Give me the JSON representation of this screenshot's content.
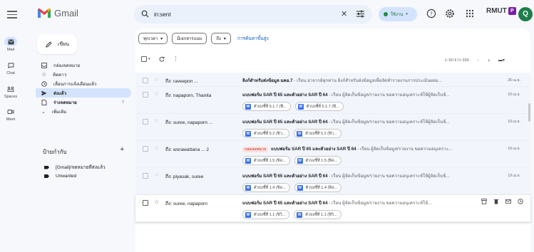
{
  "app": {
    "name": "Gmail"
  },
  "search": {
    "value": "in:sent",
    "clear_glyph": "✕"
  },
  "status": {
    "label": "ใช้งาน"
  },
  "account": {
    "org": "RMUT",
    "badge": "P",
    "avatar_letter": "Q"
  },
  "rail": [
    {
      "label": "Mail",
      "icon": "mail-icon"
    },
    {
      "label": "Chat",
      "icon": "chat-icon"
    },
    {
      "label": "Spaces",
      "icon": "spaces-icon"
    },
    {
      "label": "Meet",
      "icon": "meet-icon"
    }
  ],
  "compose": {
    "label": "เขียน"
  },
  "nav": [
    {
      "label": "กล่องจดหมาย",
      "icon": "inbox-icon",
      "count": ""
    },
    {
      "label": "ติดดาว",
      "icon": "star-icon",
      "count": ""
    },
    {
      "label": "เลื่อนการแจ้งเตือนแล้ว",
      "icon": "clock-icon",
      "count": ""
    },
    {
      "label": "ส่งแล้ว",
      "icon": "send-icon",
      "count": ""
    },
    {
      "label": "ร่างจดหมาย",
      "icon": "draft-icon",
      "count": "7"
    },
    {
      "label": "เพิ่มเติม",
      "icon": "chevron-down-icon",
      "count": ""
    }
  ],
  "labels": {
    "heading": "ป้ายกำกับ",
    "items": [
      "[Gmail]/จดหมายที่ส่งแล้ว",
      "Unwanted"
    ]
  },
  "filters": {
    "chips": [
      "ทุกเวลา",
      "มีเอกสารแนบ",
      "ถึง"
    ],
    "advanced": "การค้นหาขั้นสูง"
  },
  "pager": {
    "text": "1–50 จาก 339"
  },
  "rows": [
    {
      "sender": "ถึง: raveepon ...",
      "tag": "",
      "subject": "ลิงก์สำหรับส่งข้อมูล มคอ.7",
      "snippet": " - เรียน อาจารย์ทุกท่าน ลิงก์สำหรับส่งข้อมูลเพื่อจัดทำรายงานการประเมินผลม...",
      "date": "26 เม.ย.",
      "attachments": []
    },
    {
      "sender": "ถึง: napaporn, Thanita",
      "tag": "",
      "subject": "แบบฟอร์ม SAR ปี 65 และตัวอย่าง SAR ปี 64",
      "snippet": " - เรียน ผู้จัดเก็บข้อมูล/รายงาน ขอความอนุเคราะห์ให้ผู้จัดเก็บข้...",
      "date": "19 เม.ย.",
      "attachments": [
        "ตัวบ่งชี้ที่ 5.1.7 (ฟี...",
        "ตัวบ่งชี้ที่ 5.1.7 (ฟี..."
      ]
    },
    {
      "sender": "ถึง: suree, napaporn ...",
      "tag": "",
      "subject": "แบบฟอร์ม SAR ปี 65 และตัวอย่าง SAR ปี 64",
      "snippet": " - เรียน ผู้จัดเก็บข้อมูล/รายงาน ขอความอนุเคราะห์ให้ผู้จัดเก็บข้...",
      "date": "19 เม.ย.",
      "attachments": [
        "ตัวบ่งชี้ที่ 5.2 (ฟิว...",
        "ตัวบ่งชี้ที่ 5.2 (ฟิว..."
      ]
    },
    {
      "sender": "ถึง: worawattana ... 2",
      "tag": "กล่องจดหมาย",
      "subject": "แบบฟอร์ม SAR ปี 65 และตัวอย่าง SAR ปี 64",
      "snippet": " - เรียน ผู้จัดเก็บข้อมูล/รายงาน ขอความอนุเคราะ...",
      "date": "19 เม.ย.",
      "attachments": [
        "ตัวบ่งชี้ที่ 1.5 (ฟิล...",
        "ตัวบ่งชี้ที่ 1.5 (ฟิล..."
      ]
    },
    {
      "sender": "ถึง: piyasak, suree",
      "tag": "",
      "subject": "แบบฟอร์ม SAR ปี 65 และตัวอย่าง SAR ปี 64",
      "snippet": " - เรียน ผู้จัดเก็บข้อมูล/รายงาน ขอความอนุเคราะห์ให้ผู้จัดเก็บข้...",
      "date": "19 เม.ย.",
      "attachments": [
        "ตัวบ่งชี้ที่ 1.4 (ฟิล...",
        "ตัวบ่งชี้ที่ 1.4 (ฟิล..."
      ]
    },
    {
      "sender": "ถึง: suree, napaporn",
      "tag": "",
      "subject": "แบบฟอร์ม SAR ปี 65 และตัวอย่าง SAR ปี 64",
      "snippet": " - เรียน ผู้จัดเก็บข้อมูล/รายงาน ขอความอนุเคราะห์ให้...",
      "date": "",
      "attachments": [
        "ตัวบ่งชี้ที่ 1.1 (ฟิวิ...",
        "ตัวบ่งชี้ที่ 1.1 (ฟิวิ..."
      ]
    }
  ],
  "colors": {
    "accent": "#0b57d0",
    "selected_nav": "#d3e3fd",
    "background": "#f6f8fc"
  }
}
